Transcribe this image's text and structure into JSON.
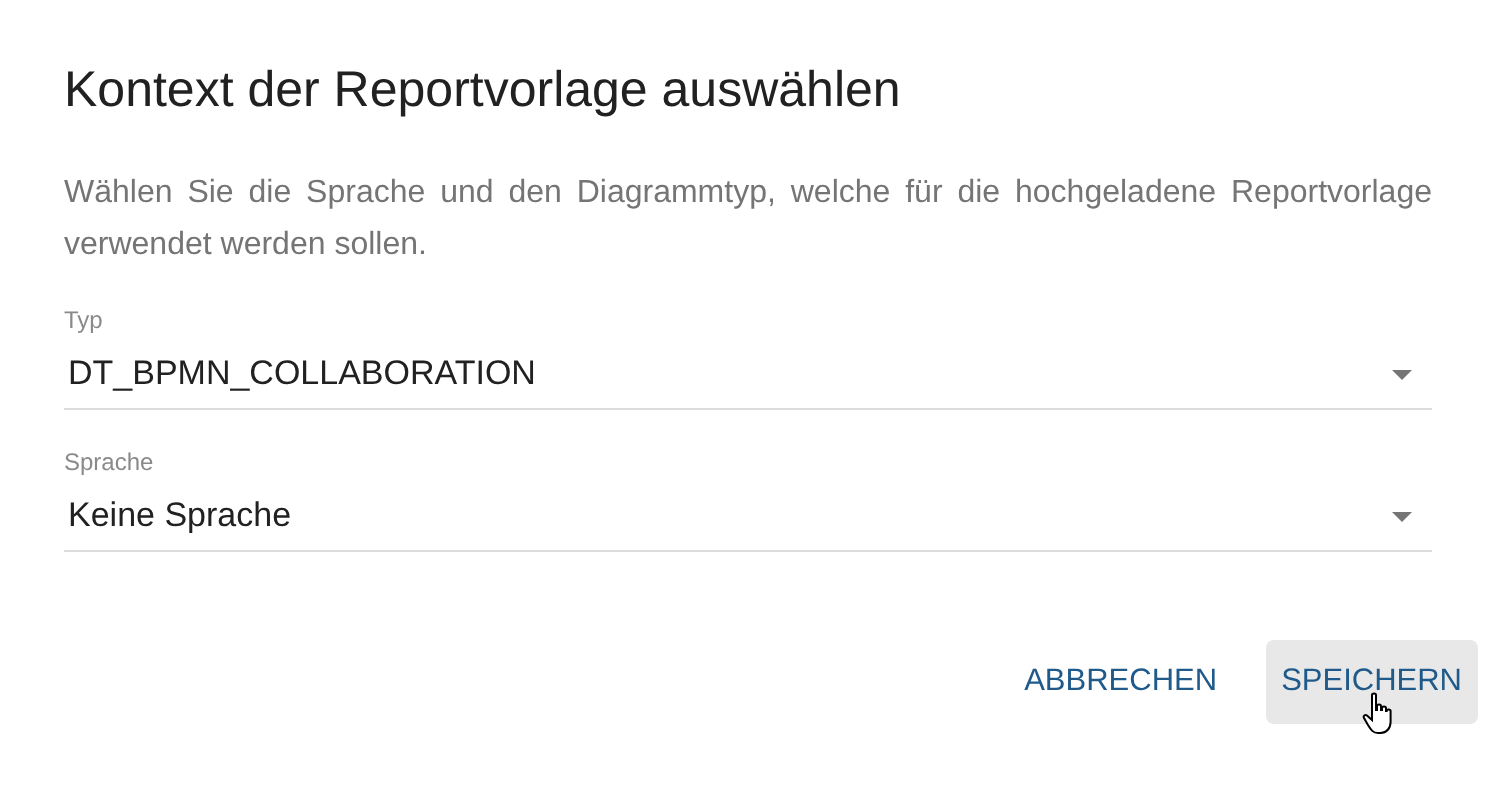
{
  "dialog": {
    "title": "Kontext der Reportvorlage auswählen",
    "description": "Wählen Sie die Sprache und den Diagrammtyp, welche für die hochgeladene Reportvorlage verwendet werden sollen.",
    "fields": [
      {
        "label": "Typ",
        "value": "DT_BPMN_COLLABORATION"
      },
      {
        "label": "Sprache",
        "value": "Keine Sprache"
      }
    ],
    "buttons": [
      {
        "label": "ABBRECHEN",
        "hovered": false
      },
      {
        "label": "SPEICHERN",
        "hovered": true
      }
    ]
  }
}
